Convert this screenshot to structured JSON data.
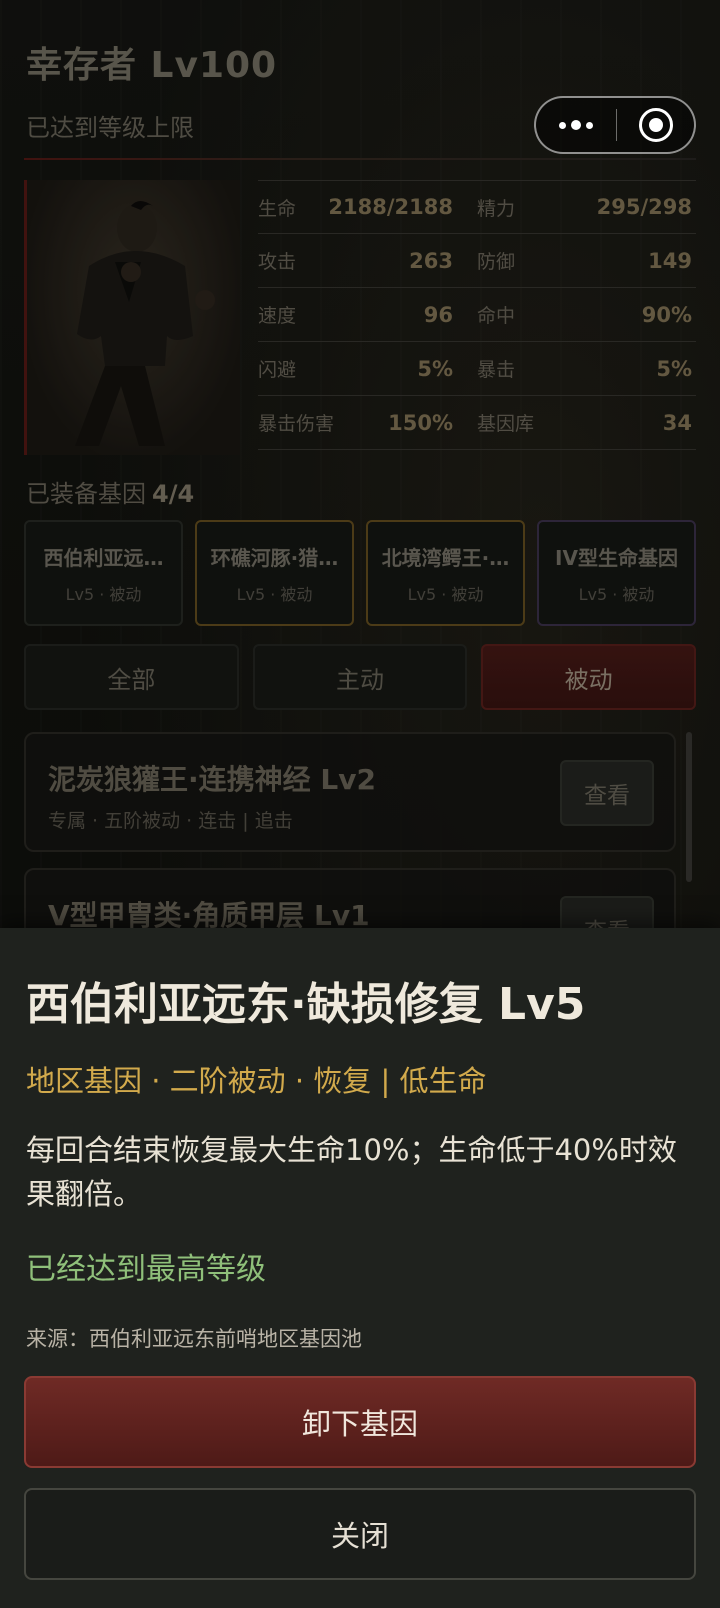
{
  "header": {
    "title": "幸存者 Lv100",
    "subtitle": "已达到等级上限"
  },
  "capsule": {
    "more_icon": "more-dots-icon",
    "close_icon": "target-close-icon"
  },
  "stats": [
    [
      {
        "label": "生命",
        "value": "2188/2188"
      },
      {
        "label": "精力",
        "value": "295/298"
      }
    ],
    [
      {
        "label": "攻击",
        "value": "263"
      },
      {
        "label": "防御",
        "value": "149"
      }
    ],
    [
      {
        "label": "速度",
        "value": "96"
      },
      {
        "label": "命中",
        "value": "90%"
      }
    ],
    [
      {
        "label": "闪避",
        "value": "5%"
      },
      {
        "label": "暴击",
        "value": "5%"
      }
    ],
    [
      {
        "label": "暴击伤害",
        "value": "150%"
      },
      {
        "label": "基因库",
        "value": "34"
      }
    ]
  ],
  "equipped": {
    "label": "已装备基因",
    "count": "4/4",
    "genes": [
      {
        "name": "西伯利亚远…",
        "meta": "Lv5 · 被动"
      },
      {
        "name": "环礁河豚·猎…",
        "meta": "Lv5 · 被动"
      },
      {
        "name": "北境湾鳄王·…",
        "meta": "Lv5 · 被动"
      },
      {
        "name": "IV型生命基因",
        "meta": "Lv5 · 被动"
      }
    ]
  },
  "tabs": [
    "全部",
    "主动",
    "被动"
  ],
  "list": [
    {
      "title": "泥炭狼獾王·连携神经 Lv2",
      "sub": "专属 · 五阶被动 · 连击 | 追击",
      "button": "查看"
    },
    {
      "title": "V型甲胄类·角质甲层 Lv1",
      "sub": "",
      "button": "查看"
    }
  ],
  "sheet": {
    "title": "西伯利亚远东·缺损修复 Lv5",
    "tags": "地区基因 · 二阶被动 · 恢复 | 低生命",
    "description": "每回合结束恢复最大生命10%；生命低于40%时效果翻倍。",
    "max_level": "已经达到最高等级",
    "source": "来源：西伯利亚远东前哨地区基因池",
    "unequip_button": "卸下基因",
    "close_button": "关闭"
  },
  "colors": {
    "accent_red": "#6f2a25",
    "tag_gold": "#d2aa4c",
    "max_green": "#8fc07a"
  }
}
